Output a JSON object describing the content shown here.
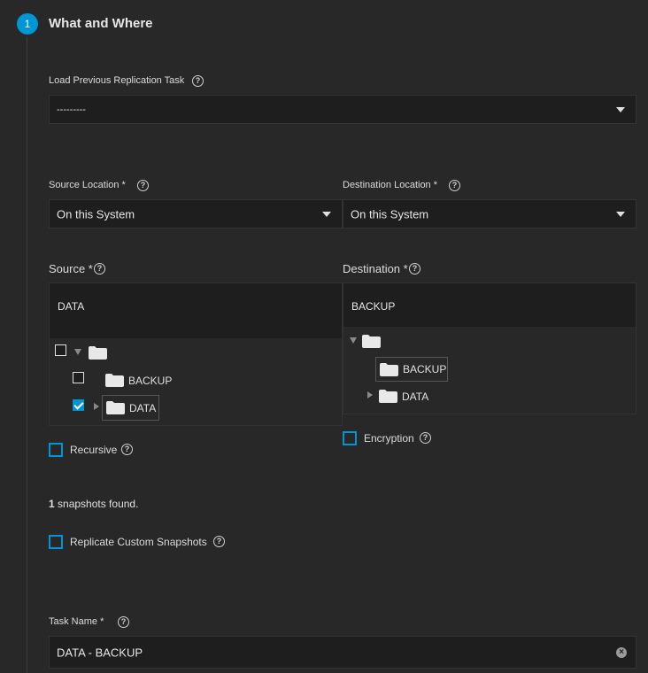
{
  "step": {
    "number": "1",
    "title": "What and Where"
  },
  "load_previous": {
    "label": "Load Previous Replication Task",
    "value": "---------"
  },
  "source_location": {
    "label": "Source Location *",
    "value": "On this System"
  },
  "destination_location": {
    "label": "Destination Location *",
    "value": "On this System"
  },
  "source": {
    "label": "Source *",
    "path": "DATA",
    "tree": {
      "child1": "BACKUP",
      "child2": "DATA"
    }
  },
  "destination": {
    "label": "Destination *",
    "path": "BACKUP",
    "tree": {
      "child1": "BACKUP",
      "child2": "DATA"
    }
  },
  "recursive": {
    "label": "Recursive"
  },
  "encryption": {
    "label": "Encryption"
  },
  "snapshots": {
    "count": "1",
    "text": " snapshots found."
  },
  "replicate_custom": {
    "label": "Replicate Custom Snapshots"
  },
  "task_name": {
    "label": "Task Name *",
    "value": "DATA - BACKUP"
  },
  "help_glyph": "?",
  "clear_glyph": "×",
  "colors": {
    "accent": "#0095d5",
    "background": "#282828",
    "field": "#1e1e1e"
  }
}
